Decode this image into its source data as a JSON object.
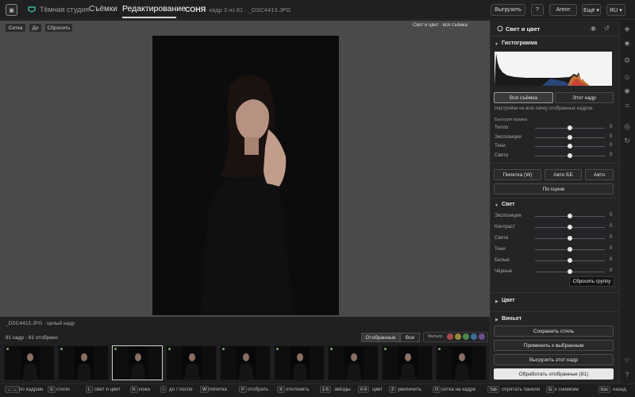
{
  "topbar": {
    "studio": "Тёмная студия",
    "nav_shoots": "Съёмки",
    "nav_edit": "Редактирование",
    "shoot_name": "СОНЯ",
    "frame_info": "· кадр 3 из 81 · _DSC4413.JPG",
    "export_btn": "Выгрузить",
    "help_btn": "?",
    "agent_btn": "Агент",
    "more_btn": "Ещё ▾",
    "lang_btn": "RU ▾"
  },
  "canvas": {
    "grid_btn": "Сетка",
    "before_btn": "До",
    "reset_btn": "Сбросить",
    "note": "Свет и цвет · вся съёмка"
  },
  "strip": {
    "caption": "_DSC4413.JPG · целый кадр",
    "count": "81 кадр · 81 отобрано",
    "tab_selected": "Отобранные",
    "tab_all": "Все",
    "filter_label": "Фильтр",
    "filter_colors": [
      "#a84a4a",
      "#9a8a3a",
      "#4e8a4e",
      "#3f6c9a",
      "#6e5090"
    ]
  },
  "panel": {
    "title": "Свет и цвет",
    "histogram_title": "Гистограмма",
    "scope_all": "Вся съёмка",
    "scope_frame": "Этот кадр",
    "scope_note": "Настройки на всю пачку отобранных кадров.",
    "quick_title": "Быстрая правка",
    "quick": [
      {
        "label": "Тепло",
        "value": "0",
        "pos": 0.5
      },
      {
        "label": "Экспозиция",
        "value": "0",
        "pos": 0.5
      },
      {
        "label": "Тени",
        "value": "0",
        "pos": 0.5
      },
      {
        "label": "Света",
        "value": "0",
        "pos": 0.5
      }
    ],
    "eyedropper_btn": "Пипетка (W)",
    "auto_wb_btn": "Авто ББ",
    "auto_btn": "Авто",
    "by_scene_btn": "По сцене",
    "light_title": "Свет",
    "light": [
      {
        "label": "Экспозиция",
        "value": "0",
        "pos": 0.5
      },
      {
        "label": "Контраст",
        "value": "0",
        "pos": 0.5
      },
      {
        "label": "Света",
        "value": "0",
        "pos": 0.5
      },
      {
        "label": "Тени",
        "value": "0",
        "pos": 0.5
      },
      {
        "label": "Белые",
        "value": "0",
        "pos": 0.5
      },
      {
        "label": "Чёрные",
        "value": "0",
        "pos": 0.5
      }
    ],
    "tooltip": "Сбросить группу",
    "color_title": "Цвет",
    "next_title": "Виньет",
    "save_style_btn": "Сохранить стиль",
    "apply_selected_btn": "Применить к выбранным",
    "export_frame_btn": "Выгрузить этот кадр",
    "process_btn": "Обработать отобранные (81)"
  },
  "hotkeys": [
    {
      "key": "← →",
      "label": "по кадрам"
    },
    {
      "key": "S",
      "label": "стили"
    },
    {
      "key": "L",
      "label": "свет и цвет"
    },
    {
      "key": "K",
      "label": "кожа"
    },
    {
      "key": "\\",
      "label": "до / после"
    },
    {
      "key": "W",
      "label": "пипетка"
    },
    {
      "key": "P",
      "label": "отобрать"
    },
    {
      "key": "X",
      "label": "отклонить"
    },
    {
      "key": "1-5",
      "label": "звёзды"
    },
    {
      "key": "6-9",
      "label": "цвет"
    },
    {
      "key": "Z",
      "label": "увеличить"
    },
    {
      "key": "O",
      "label": "сетка на кадре"
    },
    {
      "key": "Tab",
      "label": "спрятать панели"
    },
    {
      "key": "G",
      "label": "к снимкам"
    },
    {
      "key": "Esc",
      "label": "назад"
    }
  ]
}
